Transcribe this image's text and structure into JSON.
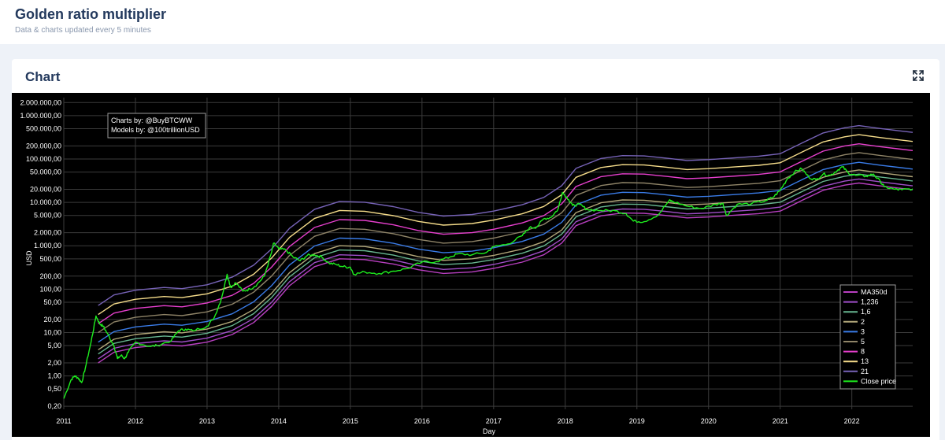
{
  "header": {
    "title": "Golden ratio multiplier",
    "subtitle": "Data & charts updated every 5 minutes"
  },
  "card": {
    "title": "Chart",
    "expand_icon": "expand-arrows-icon"
  },
  "chart_data": {
    "type": "line",
    "title": "",
    "xlabel": "Day",
    "ylabel": "USD",
    "yscale": "log",
    "ylim": [
      0.17,
      2600000
    ],
    "xlim": [
      2011.0,
      2022.85
    ],
    "grid": true,
    "background": "#000000",
    "legend_position": "bottom-right",
    "attribution": [
      "Charts by: @BuyBTCWW",
      "Models by: @100trillionUSD"
    ],
    "x_ticks": [
      {
        "value": 2011,
        "label": "2011"
      },
      {
        "value": 2012,
        "label": "2012"
      },
      {
        "value": 2013,
        "label": "2013"
      },
      {
        "value": 2014,
        "label": "2014"
      },
      {
        "value": 2015,
        "label": "2015"
      },
      {
        "value": 2016,
        "label": "2016"
      },
      {
        "value": 2017,
        "label": "2017"
      },
      {
        "value": 2018,
        "label": "2018"
      },
      {
        "value": 2019,
        "label": "2019"
      },
      {
        "value": 2020,
        "label": "2020"
      },
      {
        "value": 2021,
        "label": "2021"
      },
      {
        "value": 2022,
        "label": "2022"
      }
    ],
    "y_ticks": [
      {
        "value": 0.2,
        "label": "0,20"
      },
      {
        "value": 0.5,
        "label": "0,50"
      },
      {
        "value": 1,
        "label": "1,00"
      },
      {
        "value": 2,
        "label": "2,00"
      },
      {
        "value": 5,
        "label": "5,00"
      },
      {
        "value": 10,
        "label": "10,00"
      },
      {
        "value": 20,
        "label": "20,00"
      },
      {
        "value": 50,
        "label": "50,00"
      },
      {
        "value": 100,
        "label": "100,00"
      },
      {
        "value": 200,
        "label": "200,00"
      },
      {
        "value": 500,
        "label": "500,00"
      },
      {
        "value": 1000,
        "label": "1.000,00"
      },
      {
        "value": 2000,
        "label": "2.000,00"
      },
      {
        "value": 5000,
        "label": "5.000,00"
      },
      {
        "value": 10000,
        "label": "10.000,00"
      },
      {
        "value": 20000,
        "label": "20.000,00"
      },
      {
        "value": 50000,
        "label": "50.000,00"
      },
      {
        "value": 100000,
        "label": "100.000,00"
      },
      {
        "value": 200000,
        "label": "200.000,00"
      },
      {
        "value": 500000,
        "label": "500.000,00"
      },
      {
        "value": 1000000,
        "label": "1.000.000,00"
      },
      {
        "value": 2000000,
        "label": "2.000.000,00"
      }
    ],
    "ma350": {
      "x": [
        2011.48,
        2011.7,
        2012.0,
        2012.4,
        2012.65,
        2013.0,
        2013.35,
        2013.65,
        2013.9,
        2014.15,
        2014.5,
        2014.85,
        2015.2,
        2015.6,
        2015.95,
        2016.3,
        2016.7,
        2017.0,
        2017.4,
        2017.7,
        2017.95,
        2018.15,
        2018.5,
        2018.8,
        2019.1,
        2019.4,
        2019.7,
        2020.0,
        2020.4,
        2020.7,
        2021.0,
        2021.3,
        2021.6,
        2021.9,
        2022.1,
        2022.4,
        2022.85
      ],
      "values": [
        2.0,
        3.5,
        4.5,
        5.2,
        4.9,
        6.0,
        9.0,
        17.0,
        40.0,
        120.0,
        330.0,
        500.0,
        480.0,
        380.0,
        280.0,
        230.0,
        250.0,
        300.0,
        420.0,
        620.0,
        1150.0,
        2900.0,
        4900.0,
        5700.0,
        5600.0,
        5000.0,
        4400.0,
        4600.0,
        5100.0,
        5500.0,
        6300.0,
        11000.0,
        19000.0,
        25000.0,
        28000.0,
        24000.0,
        19500.0
      ]
    },
    "series": [
      {
        "name": "MA350d",
        "multiplier": 1,
        "color": "#b83fc0"
      },
      {
        "name": "1,236",
        "multiplier": 1.236,
        "color": "#a04ec8"
      },
      {
        "name": "1,6",
        "multiplier": 1.6,
        "color": "#67b58f"
      },
      {
        "name": "2",
        "multiplier": 2,
        "color": "#b3a87a"
      },
      {
        "name": "3",
        "multiplier": 3,
        "color": "#3a7ce8"
      },
      {
        "name": "5",
        "multiplier": 5,
        "color": "#8f8468"
      },
      {
        "name": "8",
        "multiplier": 8,
        "color": "#e63fcd"
      },
      {
        "name": "13",
        "multiplier": 13,
        "color": "#f5dc8a"
      },
      {
        "name": "21",
        "multiplier": 21,
        "color": "#7763b8"
      }
    ],
    "close_price": {
      "name": "Close price",
      "color": "#1eef1e",
      "x": [
        2011.0,
        2011.1,
        2011.15,
        2011.2,
        2011.25,
        2011.3,
        2011.38,
        2011.45,
        2011.5,
        2011.55,
        2011.6,
        2011.7,
        2011.75,
        2011.8,
        2011.85,
        2011.9,
        2012.0,
        2012.2,
        2012.3,
        2012.5,
        2012.6,
        2012.7,
        2012.8,
        2013.0,
        2013.1,
        2013.2,
        2013.28,
        2013.33,
        2013.4,
        2013.5,
        2013.6,
        2013.7,
        2013.8,
        2013.9,
        2013.93,
        2014.0,
        2014.1,
        2014.2,
        2014.3,
        2014.4,
        2014.5,
        2014.6,
        2014.7,
        2014.8,
        2014.9,
        2015.0,
        2015.05,
        2015.2,
        2015.4,
        2015.6,
        2015.8,
        2016.0,
        2016.2,
        2016.4,
        2016.5,
        2016.7,
        2016.9,
        2017.0,
        2017.2,
        2017.4,
        2017.5,
        2017.6,
        2017.7,
        2017.8,
        2017.9,
        2017.96,
        2018.05,
        2018.1,
        2018.2,
        2018.3,
        2018.5,
        2018.7,
        2018.85,
        2018.95,
        2019.1,
        2019.3,
        2019.45,
        2019.5,
        2019.7,
        2019.9,
        2020.1,
        2020.2,
        2020.25,
        2020.4,
        2020.6,
        2020.8,
        2020.9,
        2021.0,
        2021.1,
        2021.2,
        2021.3,
        2021.4,
        2021.5,
        2021.6,
        2021.7,
        2021.8,
        2021.87,
        2021.95,
        2022.05,
        2022.2,
        2022.3,
        2022.4,
        2022.45,
        2022.6,
        2022.7,
        2022.85
      ],
      "values": [
        0.3,
        0.8,
        1.0,
        0.9,
        0.7,
        1.5,
        6.0,
        24.0,
        16.0,
        14.0,
        10.0,
        5.0,
        2.5,
        3.0,
        2.5,
        3.5,
        6.0,
        4.8,
        5.0,
        6.5,
        11.0,
        12.0,
        11.0,
        14.0,
        22.0,
        60.0,
        220.0,
        110.0,
        140.0,
        90.0,
        100.0,
        130.0,
        200.0,
        700.0,
        1150.0,
        850.0,
        800.0,
        550.0,
        450.0,
        600.0,
        620.0,
        550.0,
        400.0,
        370.0,
        330.0,
        320.0,
        220.0,
        250.0,
        230.0,
        260.0,
        300.0,
        420.0,
        430.0,
        560.0,
        650.0,
        620.0,
        700.0,
        950.0,
        1100.0,
        1700.0,
        2600.0,
        2700.0,
        4200.0,
        4500.0,
        7000.0,
        17000.0,
        11500.0,
        8500.0,
        9000.0,
        6900.0,
        6500.0,
        6400.0,
        5500.0,
        3700.0,
        3600.0,
        5200.0,
        11000.0,
        10500.0,
        8200.0,
        7200.0,
        9000.0,
        9500.0,
        5000.0,
        9000.0,
        9300.0,
        11000.0,
        13000.0,
        19000.0,
        35000.0,
        50000.0,
        60000.0,
        38000.0,
        33000.0,
        45000.0,
        42000.0,
        55000.0,
        66000.0,
        48000.0,
        42000.0,
        40000.0,
        45000.0,
        30000.0,
        23000.0,
        20000.0,
        19500.0,
        20500.0
      ]
    }
  }
}
